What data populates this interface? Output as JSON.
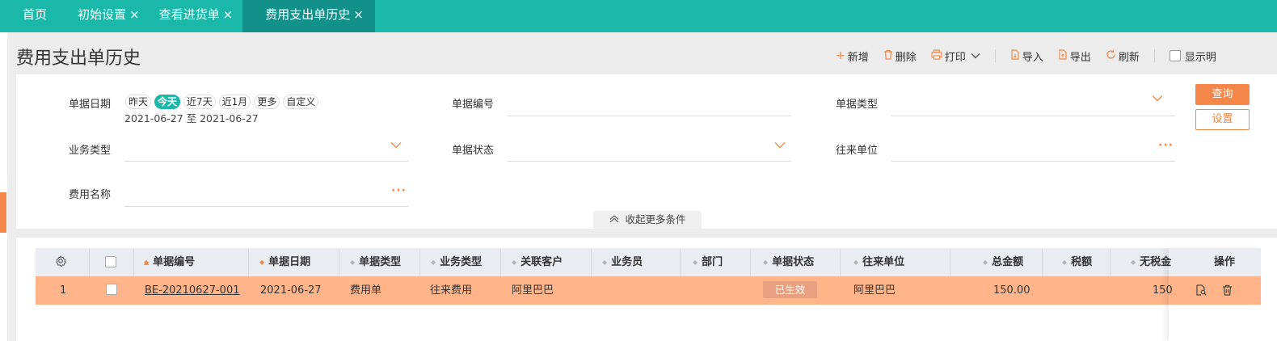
{
  "tabs": [
    {
      "label": "首页",
      "closable": false
    },
    {
      "label": "初始设置",
      "closable": true
    },
    {
      "label": "查看进货单",
      "closable": true
    },
    {
      "label": "费用支出单历史",
      "closable": true,
      "active": true
    }
  ],
  "close_glyph": "×",
  "page_title": "费用支出单历史",
  "toolbar": {
    "add": "新增",
    "delete": "删除",
    "print": "打印",
    "import": "导入",
    "export": "导出",
    "refresh": "刷新",
    "show_detail": "显示明"
  },
  "filters": {
    "date_label": "单据日期",
    "date_options": [
      "昨天",
      "今天",
      "近7天",
      "近1月",
      "更多",
      "自定义"
    ],
    "date_active": "今天",
    "date_range": "2021-06-27 至 2021-06-27",
    "doc_no_label": "单据编号",
    "doc_type_label": "单据类型",
    "biz_type_label": "业务类型",
    "doc_status_label": "单据状态",
    "partner_label": "往来单位",
    "expense_name_label": "费用名称",
    "query_button": "查询",
    "settings_button": "设置",
    "collapse_label": "收起更多条件"
  },
  "table": {
    "columns": [
      "单据编号",
      "单据日期",
      "单据类型",
      "业务类型",
      "关联客户",
      "业务员",
      "部门",
      "单据状态",
      "往来单位",
      "总金额",
      "税额",
      "无税金",
      "操作"
    ],
    "rows": [
      {
        "index": "1",
        "doc_no": "BE-20210627-001",
        "doc_date": "2021-06-27",
        "doc_type": "费用单",
        "biz_type": "往来费用",
        "customer": "阿里巴巴",
        "salesman": "",
        "department": "",
        "status": "已生效",
        "partner": "阿里巴巴",
        "total": "150.00",
        "tax": "",
        "net": "150"
      }
    ]
  },
  "colors": {
    "tab_bar": "#1ab8a8",
    "tab_active": "#12908a",
    "accent": "#f5874a",
    "row_highlight": "#ffb48a"
  }
}
